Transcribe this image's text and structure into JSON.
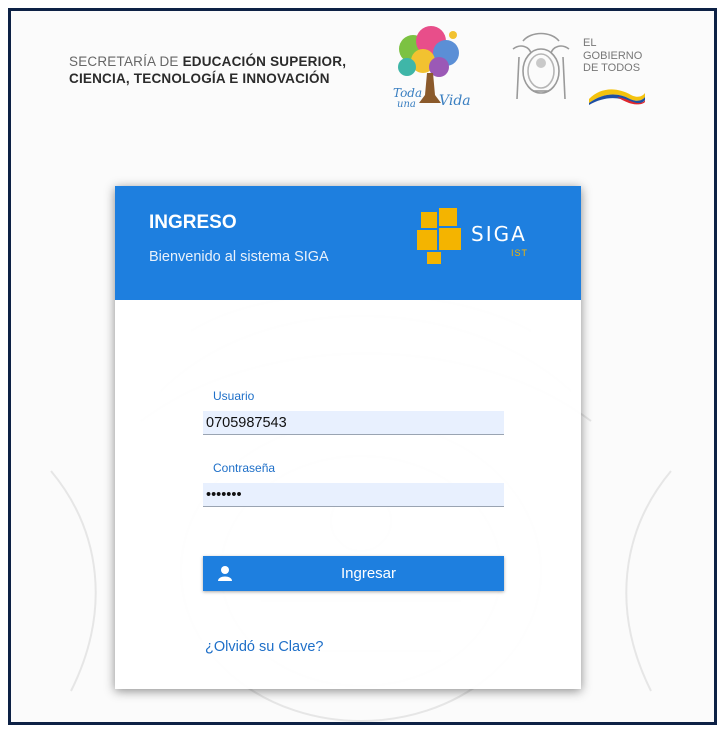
{
  "header": {
    "secretaria_line1_thin": "SECRETARÍA DE ",
    "secretaria_line1_bold": "EDUCACIÓN SUPERIOR,",
    "secretaria_line2": "CIENCIA, TECNOLOGÍA E INNOVACIÓN",
    "gobierno_line1": "EL",
    "gobierno_line2": "GOBIERNO",
    "gobierno_line3": "DE TODOS",
    "toda_una_vida_logo": "Toda una Vida"
  },
  "login": {
    "title": "INGRESO",
    "subtitle": "Bienvenido al sistema SIGA",
    "logo_word": "SIGA",
    "logo_sub": "IST",
    "usuario_label": "Usuario",
    "usuario_value": "0705987543",
    "password_label": "Contraseña",
    "password_value": "•••••••",
    "submit_label": "Ingresar",
    "forgot_link": "¿Olvidó su Clave?"
  },
  "icons": {
    "submit_icon": "user-icon",
    "header_logo": "shield-icon"
  },
  "colors": {
    "primary": "#1e7fdf",
    "frame": "#0d2145",
    "logo_accent": "#f4b400",
    "input_bg": "#e8f0fe"
  }
}
